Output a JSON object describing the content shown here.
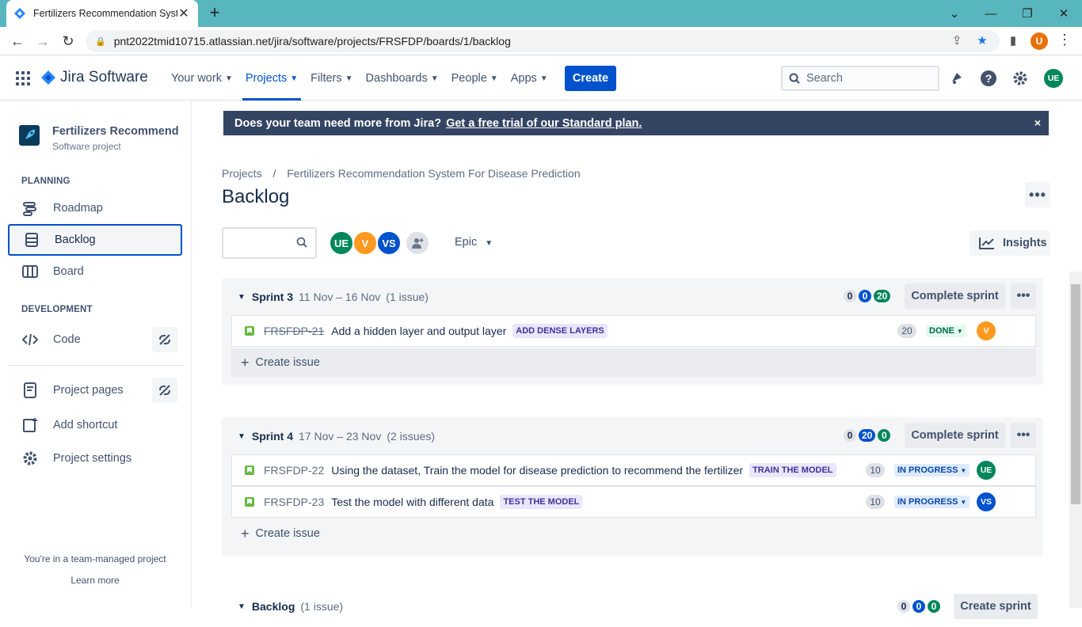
{
  "browser": {
    "tab_title": "Fertilizers Recommendation System For Disease Prediction",
    "url": "pnt2022tmid10715.atlassian.net/jira/software/projects/FRSFDP/boards/1/backlog",
    "profile_initial": "U"
  },
  "topnav": {
    "logo": "Jira Software",
    "items": [
      "Your work",
      "Projects",
      "Filters",
      "Dashboards",
      "People",
      "Apps"
    ],
    "create": "Create",
    "search_placeholder": "Search",
    "user_initials": "UE"
  },
  "sidebar": {
    "project_name": "Fertilizers Recommend...",
    "project_type": "Software project",
    "planning_header": "PLANNING",
    "planning_items": [
      "Roadmap",
      "Backlog",
      "Board"
    ],
    "development_header": "DEVELOPMENT",
    "code": "Code",
    "project_pages": "Project pages",
    "add_shortcut": "Add shortcut",
    "project_settings": "Project settings",
    "footer_text": "You're in a team-managed project",
    "learn_more": "Learn more"
  },
  "banner": {
    "text": "Does your team need more from Jira?",
    "link": "Get a free trial of our Standard plan.",
    "close": "×"
  },
  "breadcrumb": {
    "root": "Projects",
    "sep": "/",
    "project": "Fertilizers Recommendation System For Disease Prediction"
  },
  "page_title": "Backlog",
  "filters": {
    "avatars": [
      {
        "initials": "UE",
        "color": "#00875a"
      },
      {
        "initials": "V",
        "color": "#ff991f"
      },
      {
        "initials": "VS",
        "color": "#0052cc"
      }
    ],
    "epic": "Epic",
    "insights": "Insights"
  },
  "sprints": [
    {
      "name": "Sprint 3",
      "dates": "11 Nov – 16 Nov",
      "count": "(1 issue)",
      "counts": [
        "0",
        "0",
        "20"
      ],
      "action": "Complete sprint",
      "issues": [
        {
          "key": "FRSFDP-21",
          "summary": "Add a hidden layer and output layer",
          "epic": "ADD DENSE LAYERS",
          "points": "20",
          "status": "DONE",
          "assignee": "V"
        }
      ],
      "create": "Create issue"
    },
    {
      "name": "Sprint 4",
      "dates": "17 Nov – 23 Nov",
      "count": "(2 issues)",
      "counts": [
        "0",
        "20",
        "0"
      ],
      "action": "Complete sprint",
      "issues": [
        {
          "key": "FRSFDP-22",
          "summary": "Using the dataset, Train the model for disease prediction to recommend the fertilizer",
          "epic": "TRAIN THE MODEL",
          "points": "10",
          "status": "IN PROGRESS",
          "assignee": "UE"
        },
        {
          "key": "FRSFDP-23",
          "summary": "Test the model with different data",
          "epic": "TEST THE MODEL",
          "points": "10",
          "status": "IN PROGRESS",
          "assignee": "VS"
        }
      ],
      "create": "Create issue"
    }
  ],
  "backlog": {
    "name": "Backlog",
    "count": "(1 issue)",
    "counts": [
      "0",
      "0",
      "0"
    ],
    "action": "Create sprint"
  }
}
